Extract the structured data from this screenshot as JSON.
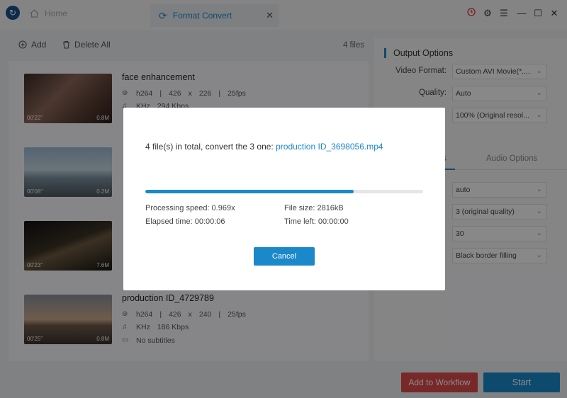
{
  "titlebar": {
    "home_tab": "Home",
    "active_tab": "Format Convert"
  },
  "toolbar": {
    "add_label": "Add",
    "delete_all_label": "Delete All",
    "file_count": "4 files"
  },
  "files": [
    {
      "name": "face enhancement",
      "codec": "h264",
      "width": "426",
      "height": "226",
      "fps": "25fps",
      "audio": "KHz",
      "bitrate": "294 Kbps",
      "duration": "00'22\"",
      "size": "0.8M"
    },
    {
      "name": "",
      "codec": "",
      "width": "",
      "height": "",
      "fps": "",
      "audio": "",
      "bitrate": "",
      "duration": "00'08\"",
      "size": "0.2M"
    },
    {
      "name": "",
      "codec": "",
      "width": "",
      "height": "",
      "fps": "",
      "audio": "",
      "bitrate": "",
      "duration": "00'23\"",
      "size": "7.6M"
    },
    {
      "name": "production ID_4729789",
      "codec": "h264",
      "width": "426",
      "height": "240",
      "fps": "25fps",
      "audio": "KHz",
      "bitrate": "186 Kbps",
      "duration": "00'25\"",
      "size": "0.8M",
      "subtitles": "No subtitles"
    }
  ],
  "output": {
    "title": "Output Options",
    "video_format_label": "Video Format:",
    "video_format_value": "Custom AVI Movie(*....",
    "quality_label": "Quality:",
    "quality_value": "Auto",
    "resolution_value": "100% (Original resol...",
    "video_tab_fragment": "s",
    "audio_tab": "Audio Options",
    "sel1": "auto",
    "sel2": "3 (original quality)",
    "sel3": "30",
    "sel4": "Black border filling"
  },
  "buttons": {
    "add_to_workflow": "Add to Workflow",
    "start": "Start"
  },
  "dialog": {
    "message_prefix": "4 file(s) in total, convert the 3 one:",
    "current_file": "production ID_3698056.mp4",
    "progress": 0.75,
    "speed_label": "Processing speed: 0.969x",
    "filesize_label": "File size: 2816kB",
    "elapsed_label": "Elapsed time: 00:00:06",
    "timeleft_label": "Time left: 00:00:00",
    "cancel": "Cancel"
  },
  "colors": {
    "accent": "#1b88c9",
    "workflow": "#d94a4a"
  }
}
